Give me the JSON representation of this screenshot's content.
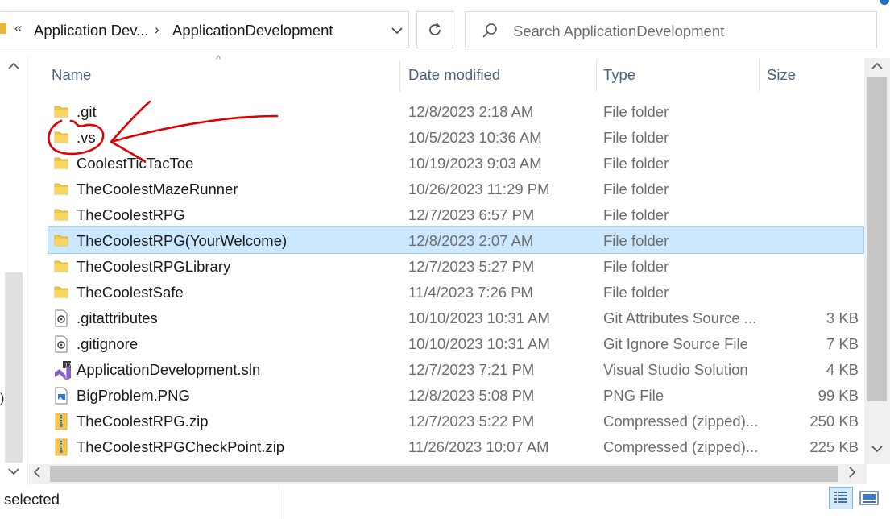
{
  "address_bar": {
    "overflow_label": "«",
    "breadcrumbs": [
      "Application Dev...",
      "ApplicationDevelopment"
    ],
    "separator": "›",
    "dropdown_label": "⌄",
    "refresh_label": "↻"
  },
  "search": {
    "placeholder": "Search ApplicationDevelopment"
  },
  "columns": {
    "name": "Name",
    "date": "Date modified",
    "type": "Type",
    "size": "Size"
  },
  "files": [
    {
      "name": ".git",
      "date": "12/8/2023 2:18 AM",
      "type": "File folder",
      "size": "",
      "icon": "folder-icon"
    },
    {
      "name": ".vs",
      "date": "10/5/2023 10:36 AM",
      "type": "File folder",
      "size": "",
      "icon": "folder-icon"
    },
    {
      "name": "CoolestTicTacToe",
      "date": "10/19/2023 9:03 AM",
      "type": "File folder",
      "size": "",
      "icon": "folder-icon"
    },
    {
      "name": "TheCoolestMazeRunner",
      "date": "10/26/2023 11:29 PM",
      "type": "File folder",
      "size": "",
      "icon": "folder-icon"
    },
    {
      "name": "TheCoolestRPG",
      "date": "12/7/2023 6:57 PM",
      "type": "File folder",
      "size": "",
      "icon": "folder-icon"
    },
    {
      "name": "TheCoolestRPG(YourWelcome)",
      "date": "12/8/2023 2:07 AM",
      "type": "File folder",
      "size": "",
      "icon": "folder-icon",
      "selected": true
    },
    {
      "name": "TheCoolestRPGLibrary",
      "date": "12/7/2023 5:27 PM",
      "type": "File folder",
      "size": "",
      "icon": "folder-icon"
    },
    {
      "name": "TheCoolestSafe",
      "date": "11/4/2023 7:26 PM",
      "type": "File folder",
      "size": "",
      "icon": "folder-icon"
    },
    {
      "name": ".gitattributes",
      "date": "10/10/2023 10:31 AM",
      "type": "Git Attributes Source ...",
      "size": "3 KB",
      "icon": "config-file-icon"
    },
    {
      "name": ".gitignore",
      "date": "10/10/2023 10:31 AM",
      "type": "Git Ignore Source File",
      "size": "7 KB",
      "icon": "config-file-icon"
    },
    {
      "name": "ApplicationDevelopment.sln",
      "date": "12/7/2023 7:21 PM",
      "type": "Visual Studio Solution",
      "size": "4 KB",
      "icon": "visual-studio-solution-icon"
    },
    {
      "name": "BigProblem.PNG",
      "date": "12/8/2023 5:08 PM",
      "type": "PNG File",
      "size": "99 KB",
      "icon": "png-image-icon"
    },
    {
      "name": "TheCoolestRPG.zip",
      "date": "12/7/2023 5:22 PM",
      "type": "Compressed (zipped)...",
      "size": "250 KB",
      "icon": "zip-folder-icon"
    },
    {
      "name": "TheCoolestRPGCheckPoint.zip",
      "date": "11/26/2023 10:07 AM",
      "type": "Compressed (zipped)...",
      "size": "225 KB",
      "icon": "zip-folder-icon"
    }
  ],
  "status_bar": {
    "text": "selected"
  },
  "nav_pane": {
    "clipped_text": ")"
  },
  "colors": {
    "selection": "#cce8ff",
    "folder": "#e6b73c",
    "annotation": "#e00000"
  }
}
